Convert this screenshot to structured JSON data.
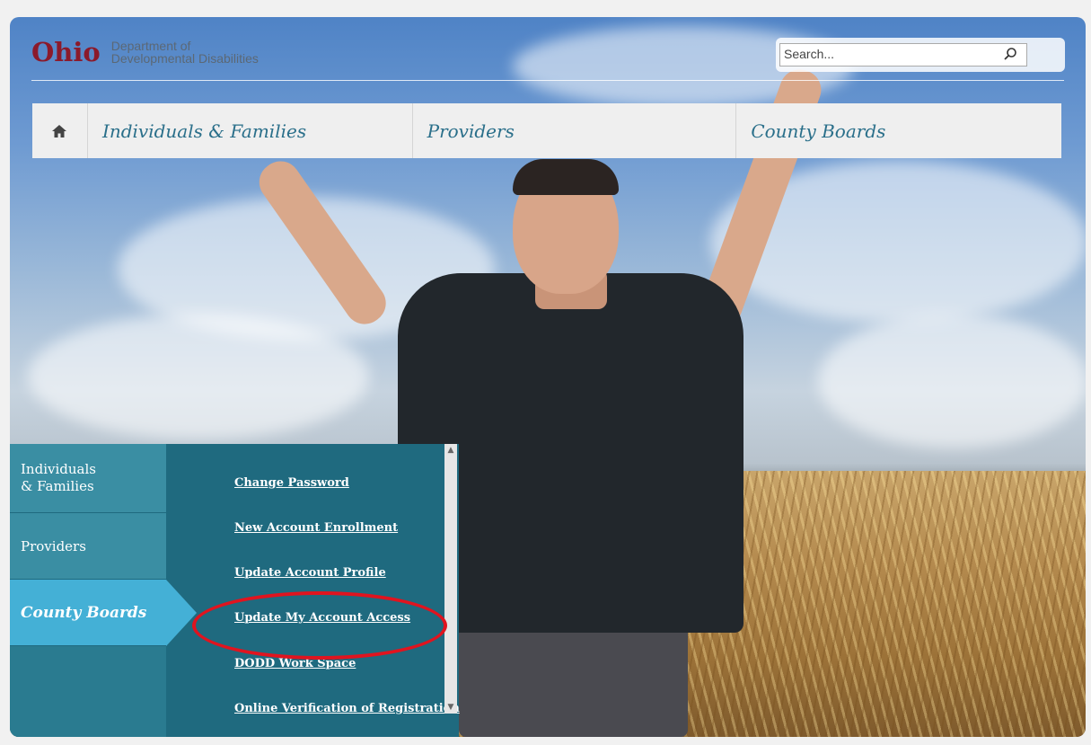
{
  "brand": {
    "logo_text": "Ohio",
    "dept_line1": "Department of",
    "dept_line2": "Developmental Disabilities"
  },
  "search": {
    "placeholder": "Search...",
    "icon": "search-icon"
  },
  "nav": {
    "home_icon": "home-icon",
    "items": [
      {
        "label": "Individuals & Families"
      },
      {
        "label": "Providers"
      },
      {
        "label": "County Boards"
      }
    ]
  },
  "side_menu": {
    "categories": [
      {
        "label": "Individuals & Families"
      },
      {
        "label": "Providers"
      },
      {
        "label": "County Boards"
      }
    ],
    "links": [
      {
        "label": "Change Password"
      },
      {
        "label": "New Account Enrollment"
      },
      {
        "label": "Update Account Profile"
      },
      {
        "label": "Update My Account Access"
      },
      {
        "label": "DODD Work Space"
      },
      {
        "label": "Online Verification of Registration"
      }
    ]
  },
  "colors": {
    "highlight": "#e0141f",
    "active_category": "#44b0d6",
    "panel": "#1f6a7f",
    "brand": "#8b1a2b"
  }
}
